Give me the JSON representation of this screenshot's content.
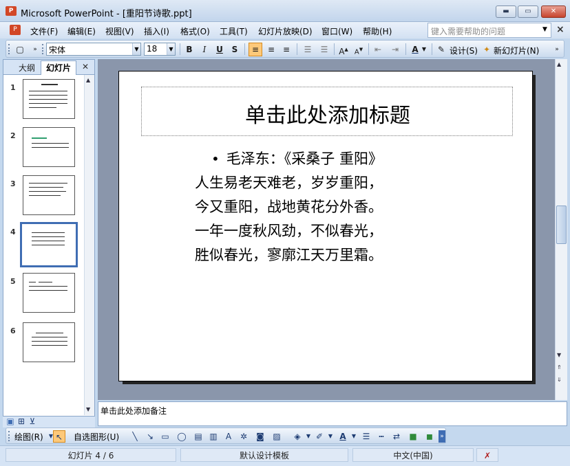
{
  "window": {
    "title": "Microsoft PowerPoint - [重阳节诗歌.ppt]",
    "app_icon": "powerpoint-icon",
    "min_glyph": "▬",
    "max_glyph": "▭",
    "close_glyph": "✕"
  },
  "menu": {
    "items": [
      "文件(F)",
      "编辑(E)",
      "视图(V)",
      "插入(I)",
      "格式(O)",
      "工具(T)",
      "幻灯片放映(D)",
      "窗口(W)",
      "帮助(H)"
    ],
    "help_placeholder": "键入需要帮助的问题"
  },
  "format_toolbar": {
    "font_name": "宋体",
    "font_size": "18",
    "bold": "B",
    "italic": "I",
    "underline": "U",
    "shadow": "S",
    "design_label": "设计(S)",
    "new_slide_label": "新幻灯片(N)"
  },
  "left_pane": {
    "tab_outline": "大纲",
    "tab_slides": "幻灯片",
    "close_glyph": "✕",
    "thumbnails": [
      {
        "number": "1"
      },
      {
        "number": "2"
      },
      {
        "number": "3"
      },
      {
        "number": "4",
        "selected": true
      },
      {
        "number": "5"
      },
      {
        "number": "6"
      }
    ]
  },
  "slide": {
    "title": "单击此处添加标题",
    "bullet": "•",
    "body_lines": [
      "毛泽东：《采桑子 重阳》",
      "人生易老天难老，岁岁重阳，",
      "今又重阳，战地黄花分外香。",
      "一年一度秋风劲，不似春光，",
      "胜似春光，寥廓江天万里霜。"
    ]
  },
  "notes": {
    "placeholder": "单击此处添加备注"
  },
  "drawing_toolbar": {
    "draw_label": "绘图(R)",
    "autoshapes_label": "自选图形(U)"
  },
  "status_bar": {
    "slide_position": "幻灯片 4 / 6",
    "template": "默认设计模板",
    "language": "中文(中国)"
  },
  "colors": {
    "accent": "#3f6db3",
    "title_bar": "#c2d5ec",
    "canvas_bg": "#8a96ab",
    "close_button": "#c7432d"
  }
}
